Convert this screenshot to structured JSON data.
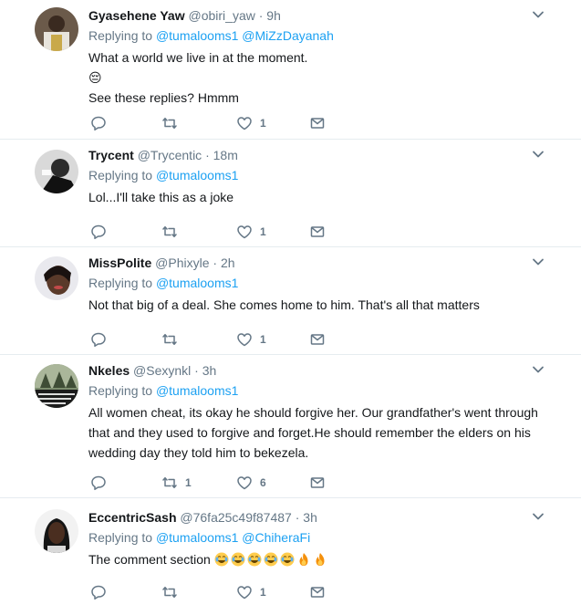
{
  "reply_prefix": "Replying to",
  "tweets": [
    {
      "name": "Gyasehene Yaw",
      "handle": "@obiri_yaw",
      "dot": "·",
      "time": "9h",
      "mentions": [
        "@tumalooms1",
        "@MiZzDayanah"
      ],
      "lines": [
        "What a world we live in at the moment.",
        "😔",
        "See these replies?  Hmmm"
      ],
      "retweets": "",
      "likes": "1"
    },
    {
      "name": "Trycent",
      "handle": "@Trycentic",
      "dot": "·",
      "time": "18m",
      "mentions": [
        "@tumalooms1"
      ],
      "lines": [
        "Lol...I'll take this as a joke"
      ],
      "retweets": "",
      "likes": "1"
    },
    {
      "name": "MissPolite",
      "handle": "@Phixyle",
      "dot": "·",
      "time": "2h",
      "mentions": [
        "@tumalooms1"
      ],
      "lines": [
        "Not that big of a deal. She comes home to him. That's all that matters"
      ],
      "retweets": "",
      "likes": "1"
    },
    {
      "name": "Nkeles",
      "handle": "@Sexynkl",
      "dot": "·",
      "time": "3h",
      "mentions": [
        "@tumalooms1"
      ],
      "lines": [
        "All women cheat, its okay he should forgive her. Our grandfather's went through that and they used to forgive and forget.He should remember the elders on his wedding day they told him to bekezela."
      ],
      "retweets": "1",
      "likes": "6"
    },
    {
      "name": "EccentricSash",
      "handle": "@76fa25c49f87487",
      "dot": "·",
      "time": "3h",
      "mentions": [
        "@tumalooms1",
        "@ChiheraFi"
      ],
      "lines": [
        "The comment section"
      ],
      "retweets": "",
      "likes": "1"
    }
  ]
}
